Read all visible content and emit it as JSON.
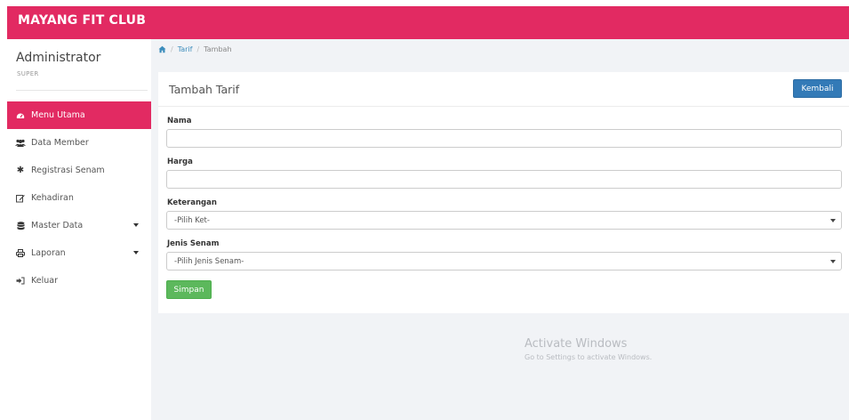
{
  "app": {
    "brand": "MAYANG FIT CLUB"
  },
  "user": {
    "name": "Administrator",
    "role": "SUPER"
  },
  "sidebar": {
    "items": [
      {
        "label": "Menu Utama",
        "icon": "dashboard-icon",
        "active": true
      },
      {
        "label": "Data Member",
        "icon": "users-icon"
      },
      {
        "label": "Registrasi Senam",
        "icon": "gear-icon"
      },
      {
        "label": "Kehadiran",
        "icon": "edit-icon"
      },
      {
        "label": "Master Data",
        "icon": "database-icon",
        "has_submenu": true
      },
      {
        "label": "Laporan",
        "icon": "print-icon",
        "has_submenu": true
      },
      {
        "label": "Keluar",
        "icon": "sign-out-icon"
      }
    ]
  },
  "breadcrumb": {
    "home_icon": "home-icon",
    "items": [
      "Tarif",
      "Tambah"
    ]
  },
  "form": {
    "title": "Tambah Tarif",
    "back_label": "Kembali",
    "fields": {
      "nama": {
        "label": "Nama",
        "value": ""
      },
      "harga": {
        "label": "Harga",
        "value": ""
      },
      "keterangan": {
        "label": "Keterangan",
        "selected": "-Pilih Ket-"
      },
      "jenis_senam": {
        "label": "Jenis Senam",
        "selected": "-Pilih Jenis Senam-"
      }
    },
    "submit_label": "Simpan"
  },
  "watermark": {
    "title": "Activate Windows",
    "subtitle": "Go to Settings to activate Windows."
  },
  "colors": {
    "brand": "#e22a62",
    "primary_button": "#337ab7",
    "success_button": "#5cb85c",
    "link": "#3c8dbc"
  }
}
